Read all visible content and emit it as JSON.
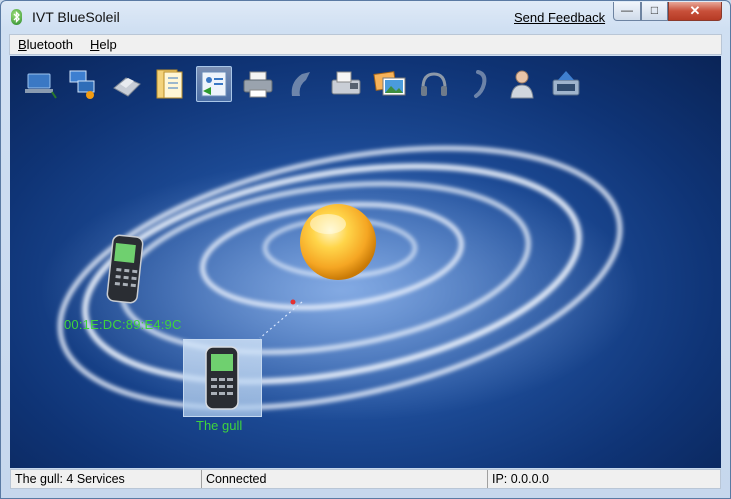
{
  "window": {
    "title": "IVT BlueSoleil",
    "feedback_link": "Send Feedback"
  },
  "menubar": {
    "items": [
      {
        "first": "B",
        "rest": "luetooth"
      },
      {
        "first": "H",
        "rest": "elp"
      }
    ]
  },
  "toolbar": {
    "icons": [
      "network-icon",
      "network-share-icon",
      "printer-service-icon",
      "file-transfer-icon",
      "contacts-sync-icon",
      "printer-icon",
      "audio-gateway-icon",
      "fax-icon",
      "image-transfer-icon",
      "headset-icon",
      "headphone-icon",
      "user-icon",
      "serial-port-icon"
    ],
    "selected": "contacts-sync-icon"
  },
  "devices": [
    {
      "name": "00:1E:DC:89:E4:9C",
      "icon": "mobile-phone-icon"
    },
    {
      "name": "The gull",
      "icon": "mobile-phone-icon",
      "selected": true
    }
  ],
  "statusbar": {
    "device_info": "The gull: 4 Services",
    "connection": "Connected",
    "ip": "IP: 0.0.0.0"
  },
  "colors": {
    "background": "#1f4f9c",
    "device_label": "#3ed43e",
    "orb": "#f5a623",
    "close_button": "#c8503a"
  }
}
